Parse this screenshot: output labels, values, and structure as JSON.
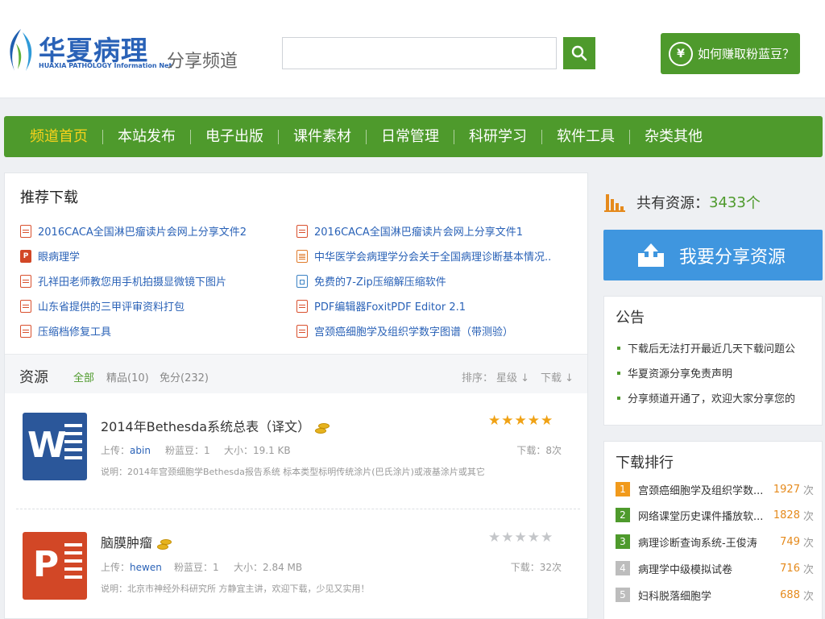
{
  "header": {
    "logo_cn": "华夏病理",
    "logo_en": "HUAXIA PATHOLOGY Information Net",
    "channel": "分享频道",
    "search_placeholder": "",
    "earn_button": "如何赚取粉蓝豆？",
    "earn_icon_glyph": "¥"
  },
  "nav": {
    "items": [
      "频道首页",
      "本站发布",
      "电子出版",
      "课件素材",
      "日常管理",
      "科研学习",
      "软件工具",
      "杂类其他"
    ],
    "active_index": 0
  },
  "recommend": {
    "title": "推荐下载",
    "items": [
      {
        "label": "2016CACA全国淋巴瘤读片会网上分享文件2",
        "icon": "file-icon"
      },
      {
        "label": "2016CACA全国淋巴瘤读片会网上分享文件1",
        "icon": "file-icon"
      },
      {
        "label": "眼病理学",
        "icon": "ppt-icon"
      },
      {
        "label": "中华医学会病理学分会关于全国病理诊断基本情况..",
        "icon": "doc-icon"
      },
      {
        "label": "孔祥田老师教您用手机拍摄显微镜下图片",
        "icon": "file-icon"
      },
      {
        "label": "免费的7-Zip压缩解压缩软件",
        "icon": "exe-icon"
      },
      {
        "label": "山东省提供的三甲评审资料打包",
        "icon": "file-icon"
      },
      {
        "label": "PDF编辑器FoxitPDF Editor 2.1",
        "icon": "file-icon"
      },
      {
        "label": "压缩档修复工具",
        "icon": "file-icon"
      },
      {
        "label": "宫颈癌细胞学及组织学数字图谱（带测验）",
        "icon": "file-icon"
      }
    ],
    "ppt_glyph": "P"
  },
  "resources": {
    "label": "资源",
    "tabs": [
      "全部",
      "精品(10)",
      "免分(232)"
    ],
    "active_tab": 0,
    "sort_label": "排序：",
    "sort_options": [
      "星级 ↓",
      "下载 ↓"
    ]
  },
  "files": [
    {
      "title": "2014年Bethesda系统总表（译文）",
      "type": "word-icon",
      "glyph": "W",
      "uploader_label": "上传：",
      "uploader": "abin",
      "beans": "粉蓝豆：1",
      "size": "大小：19.1 KB",
      "downloads": "下载：8次",
      "desc": "说明：2014年宫颈细胞学Bethesda报告系统 标本类型标明传统涂片(巴氏涂片)或液基涂片或其它",
      "rating": 5,
      "stars": "★★★★★"
    },
    {
      "title": "脑膜肿瘤",
      "type": "ppt-icon",
      "glyph": "P",
      "uploader_label": "上传：",
      "uploader": "hewen",
      "beans": "粉蓝豆：1",
      "size": "大小：2.84 MB",
      "downloads": "下载：32次",
      "desc": "说明：北京市神经外科研究所 方静宜主讲，欢迎下载，少见又实用！",
      "rating": 0,
      "stars": "★★★★★"
    }
  ],
  "stats": {
    "label": "共有资源：",
    "count": "3433",
    "unit": "个"
  },
  "share_button": "我要分享资源",
  "notice": {
    "title": "公告",
    "items": [
      "下载后无法打开最近几天下载问题公",
      "华夏资源分享免责声明",
      "分享频道开通了，欢迎大家分享您的"
    ]
  },
  "ranking": {
    "title": "下载排行",
    "unit": "次",
    "items": [
      {
        "rank": "1",
        "name": "宫颈癌细胞学及组织学数...",
        "count": "1927",
        "color": "#f19a1c"
      },
      {
        "rank": "2",
        "name": "网络课堂历史课件播放软...",
        "count": "1828",
        "color": "#4e9a2c"
      },
      {
        "rank": "3",
        "name": "病理诊断查询系统-王俊涛",
        "count": "749",
        "color": "#4e9a2c"
      },
      {
        "rank": "4",
        "name": "病理学中级模拟试卷",
        "count": "716",
        "color": "#bdbdbd"
      },
      {
        "rank": "5",
        "name": "妇科脱落细胞学",
        "count": "688",
        "color": "#bdbdbd"
      }
    ]
  },
  "colors": {
    "brand_green": "#4e9a2c",
    "brand_blue": "#2a62b7",
    "nav_active": "#f8d21b",
    "share_blue": "#3f96df",
    "accent_orange": "#e58a1c"
  }
}
